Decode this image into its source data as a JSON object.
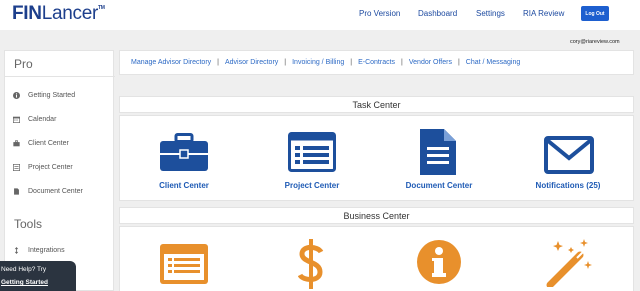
{
  "header": {
    "logo_fin": "FIN",
    "logo_lancer": "Lancer",
    "logo_tm": "TM",
    "nav": [
      "Pro Version",
      "Dashboard",
      "Settings",
      "RIA Review"
    ],
    "logout_label": "Log Out",
    "user_email": "cory@riareview.com"
  },
  "sidebar": {
    "section_pro": "Pro",
    "items": [
      {
        "label": "Getting Started",
        "icon": "info-circle-icon"
      },
      {
        "label": "Calendar",
        "icon": "calendar-icon"
      },
      {
        "label": "Client Center",
        "icon": "briefcase-icon"
      },
      {
        "label": "Project Center",
        "icon": "list-icon"
      },
      {
        "label": "Document Center",
        "icon": "document-icon"
      }
    ],
    "section_tools": "Tools",
    "tools_items": [
      {
        "label": "Integrations",
        "icon": "arrows-icon"
      }
    ]
  },
  "help": {
    "line1": "Need Help? Try",
    "line2": "Getting Started"
  },
  "links": [
    "Manage Advisor Directory",
    "Advisor Directory",
    "Invoicing / Billing",
    "E-Contracts",
    "Vendor Offers",
    "Chat / Messaging"
  ],
  "task_center": {
    "title": "Task Center",
    "tiles": [
      {
        "label": "Client Center",
        "icon": "briefcase-icon"
      },
      {
        "label": "Project Center",
        "icon": "list-window-icon"
      },
      {
        "label": "Document Center",
        "icon": "document-icon"
      },
      {
        "label": "Notifications (25)",
        "icon": "envelope-icon"
      }
    ]
  },
  "business_center": {
    "title": "Business Center",
    "tiles": [
      {
        "icon": "list-window-icon"
      },
      {
        "icon": "dollar-icon"
      },
      {
        "icon": "info-circle-icon"
      },
      {
        "icon": "magic-wand-icon"
      }
    ]
  },
  "colors": {
    "brand_blue": "#1d4f9c",
    "link_blue": "#2d6ac5",
    "orange": "#e8902c",
    "logout_bg": "#1d5fcf"
  }
}
